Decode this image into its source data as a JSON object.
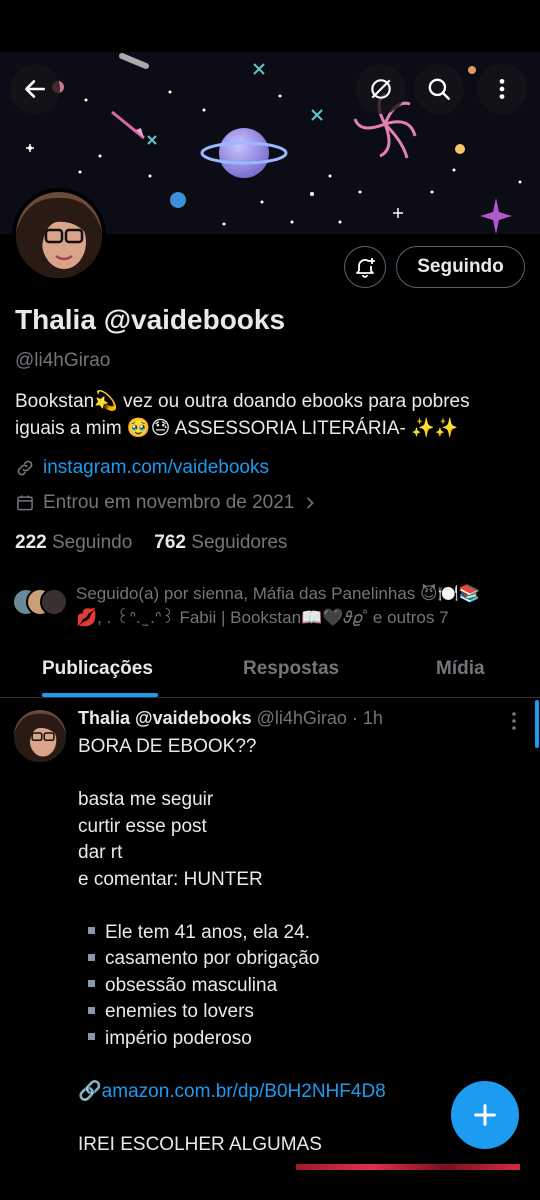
{
  "profile": {
    "name_line": "Thalia @vaidebooks",
    "handle": "@li4hGirao",
    "bio_line1": "Bookstan💫 vez ou outra doando ebooks para pobres",
    "bio_line2": "iguais a mim 🥹😓 ASSESSORIA LITERÁRIA-  ✨✨",
    "link": "instagram.com/vaidebooks",
    "joined": "Entrou em novembro de 2021",
    "following_count": "222",
    "following_label": "Seguindo",
    "followers_count": "762",
    "followers_label": "Seguidores",
    "follow_button": "Seguindo",
    "followed_by_line1": "Seguido(a) por sienna, Máfia das Panelinhas 😈🍽️📚",
    "followed_by_line2": "💋, . ꒰ᐢ. ̫ .ᐢ꒱ Fabii | Bookstan📖🖤𝜗𝜚˚ e outros 7"
  },
  "tabs": [
    "Publicações",
    "Respostas",
    "Mídia"
  ],
  "post": {
    "author": "Thalia @vaidebooks",
    "meta": " @li4hGirao · 1h",
    "lines": [
      "BORA DE EBOOK??",
      "",
      "basta me seguir",
      "curtir esse post",
      "dar rt",
      "e comentar: HUNTER",
      ""
    ],
    "bullets": [
      "Ele tem 41 anos, ela 24.",
      "casamento por obrigação",
      "obsessão masculina",
      "enemies to lovers",
      "império poderoso"
    ],
    "link": "amazon.com.br/dp/B0H2NHF4D8",
    "link_prefix": "🔗",
    "last_line": "IREI ESCOLHER ALGUMAS"
  },
  "icons": {
    "back": "arrow-left-icon",
    "translate": "no-translate-icon",
    "search": "search-icon",
    "more": "more-vertical-icon",
    "bell": "bell-plus-icon",
    "link": "link-icon",
    "calendar": "calendar-icon",
    "fab": "plus-icon"
  },
  "colors": {
    "accent": "#1d9bf0",
    "background": "#000000",
    "muted": "#71767b"
  }
}
